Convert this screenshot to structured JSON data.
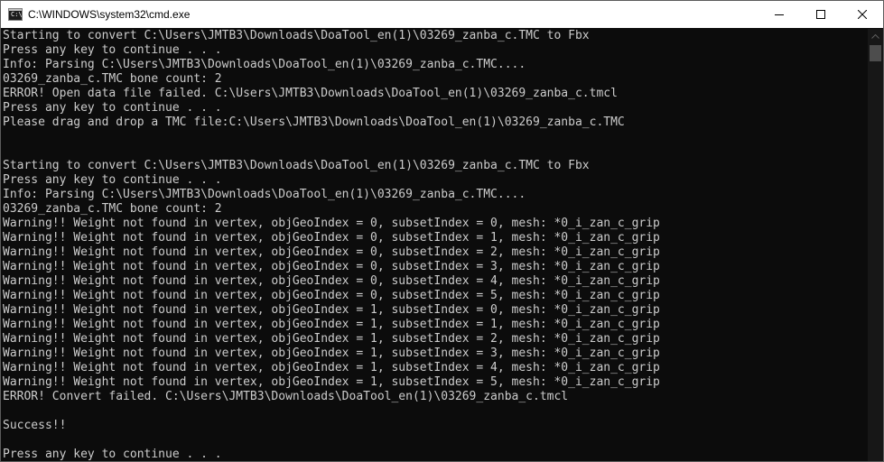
{
  "window": {
    "title": "C:\\WINDOWS\\system32\\cmd.exe",
    "icon": "cmd-icon",
    "icon_text": "C:\\",
    "controls": [
      "minimize-icon",
      "maximize-icon",
      "close-icon"
    ]
  },
  "console": {
    "background": "#0c0c0c",
    "text_color": "#cccccc",
    "lines": [
      "Starting to convert C:\\Users\\JMTB3\\Downloads\\DoaTool_en(1)\\03269_zanba_c.TMC to Fbx",
      "Press any key to continue . . .",
      "Info: Parsing C:\\Users\\JMTB3\\Downloads\\DoaTool_en(1)\\03269_zanba_c.TMC....",
      "03269_zanba_c.TMC bone count: 2",
      "ERROR! Open data file failed. C:\\Users\\JMTB3\\Downloads\\DoaTool_en(1)\\03269_zanba_c.tmcl",
      "Press any key to continue . . .",
      "Please drag and drop a TMC file:C:\\Users\\JMTB3\\Downloads\\DoaTool_en(1)\\03269_zanba_c.TMC",
      "",
      "",
      "Starting to convert C:\\Users\\JMTB3\\Downloads\\DoaTool_en(1)\\03269_zanba_c.TMC to Fbx",
      "Press any key to continue . . .",
      "Info: Parsing C:\\Users\\JMTB3\\Downloads\\DoaTool_en(1)\\03269_zanba_c.TMC....",
      "03269_zanba_c.TMC bone count: 2",
      "Warning!! Weight not found in vertex, objGeoIndex = 0, subsetIndex = 0, mesh: *0_i_zan_c_grip",
      "Warning!! Weight not found in vertex, objGeoIndex = 0, subsetIndex = 1, mesh: *0_i_zan_c_grip",
      "Warning!! Weight not found in vertex, objGeoIndex = 0, subsetIndex = 2, mesh: *0_i_zan_c_grip",
      "Warning!! Weight not found in vertex, objGeoIndex = 0, subsetIndex = 3, mesh: *0_i_zan_c_grip",
      "Warning!! Weight not found in vertex, objGeoIndex = 0, subsetIndex = 4, mesh: *0_i_zan_c_grip",
      "Warning!! Weight not found in vertex, objGeoIndex = 0, subsetIndex = 5, mesh: *0_i_zan_c_grip",
      "Warning!! Weight not found in vertex, objGeoIndex = 1, subsetIndex = 0, mesh: *0_i_zan_c_grip",
      "Warning!! Weight not found in vertex, objGeoIndex = 1, subsetIndex = 1, mesh: *0_i_zan_c_grip",
      "Warning!! Weight not found in vertex, objGeoIndex = 1, subsetIndex = 2, mesh: *0_i_zan_c_grip",
      "Warning!! Weight not found in vertex, objGeoIndex = 1, subsetIndex = 3, mesh: *0_i_zan_c_grip",
      "Warning!! Weight not found in vertex, objGeoIndex = 1, subsetIndex = 4, mesh: *0_i_zan_c_grip",
      "Warning!! Weight not found in vertex, objGeoIndex = 1, subsetIndex = 5, mesh: *0_i_zan_c_grip",
      "ERROR! Convert failed. C:\\Users\\JMTB3\\Downloads\\DoaTool_en(1)\\03269_zanba_c.tmcl",
      "",
      "Success!!",
      "",
      "Press any key to continue . . ."
    ]
  },
  "scrollbar": {
    "up_icon": "scroll-up-arrow-icon",
    "position_fraction": 0.0
  }
}
